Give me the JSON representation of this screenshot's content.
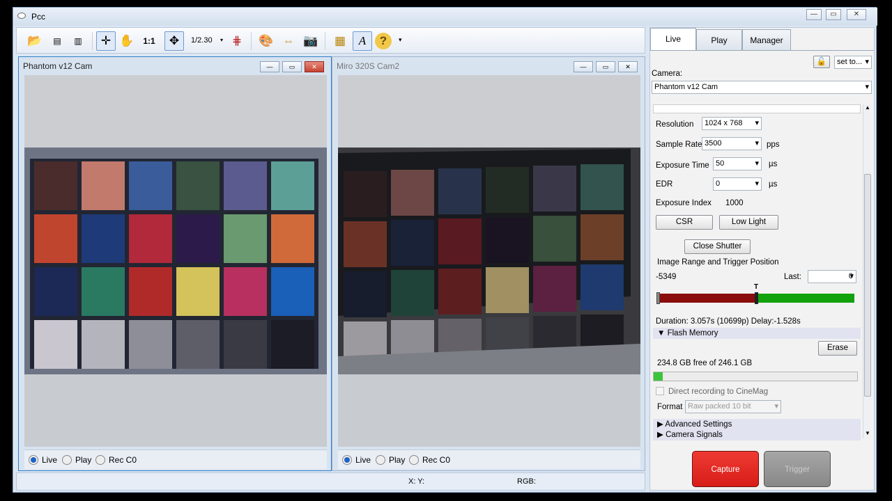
{
  "window": {
    "title": "Pcc",
    "min": "—",
    "max": "▭",
    "close": "✕"
  },
  "toolbar": {
    "zoom": "1/2.30",
    "zoom_arrow": "▾",
    "help_arrow": "▾",
    "icons": {
      "open": "📂",
      "hand": "✋",
      "one": "1:1",
      "move": "✥",
      "graph": "⋕",
      "color": "🎨",
      "flip": "⇔",
      "camera": "📷",
      "grid": "▦",
      "text": "A",
      "help": "?"
    }
  },
  "cam1": {
    "title": "Phantom v12 Cam",
    "modes": [
      "Live",
      "Play",
      "Rec C0"
    ],
    "selected": "Live"
  },
  "cam2": {
    "title": "Miro 320S Cam2",
    "modes": [
      "Live",
      "Play",
      "Rec C0"
    ],
    "selected": "Live"
  },
  "cam_btns": {
    "min": "—",
    "max": "▭",
    "close": "✕"
  },
  "status": {
    "xy": "X: Y:",
    "rgb": "RGB:"
  },
  "panel": {
    "tabs": [
      "Live",
      "Play",
      "Manager"
    ],
    "selected_tab": "Live",
    "set_to": "set to...",
    "camera_label": "Camera:",
    "camera_value": "Phantom v12 Cam",
    "resolution_label": "Resolution",
    "resolution": "1024 x 768",
    "sample_rate_label": "Sample Rate",
    "sample_rate": "3500",
    "pps": "pps",
    "exposure_label": "Exposure Time",
    "exposure": "50",
    "us": "µs",
    "edr_label": "EDR",
    "edr": "0",
    "ei_label": "Exposure Index",
    "ei": "1000",
    "csr": "CSR",
    "low_light": "Low Light",
    "close_shutter": "Close Shutter",
    "range_label": "Image Range and Trigger Position",
    "first": "-5349",
    "last_label": "Last:",
    "last": "0",
    "trigger_marker": "T",
    "duration": "Duration: 3.057s (10699p) Delay:-1.528s",
    "flash_memory": "Flash Memory",
    "erase": "Erase",
    "mem_text": "234.8 GB free of 246.1 GB",
    "mem_used_fraction": 0.046,
    "direct_rec": "Direct recording to CineMag",
    "format_label": "Format",
    "format": "Raw packed 10 bit",
    "advanced": "Advanced Settings",
    "signals": "Camera Signals",
    "capture": "Capture",
    "trigger": "Trigger"
  },
  "colors": {
    "accent": "#2d7fc6",
    "capture": "#e02b25",
    "range_red": "#8a0c0c",
    "range_green": "#12a20d"
  }
}
